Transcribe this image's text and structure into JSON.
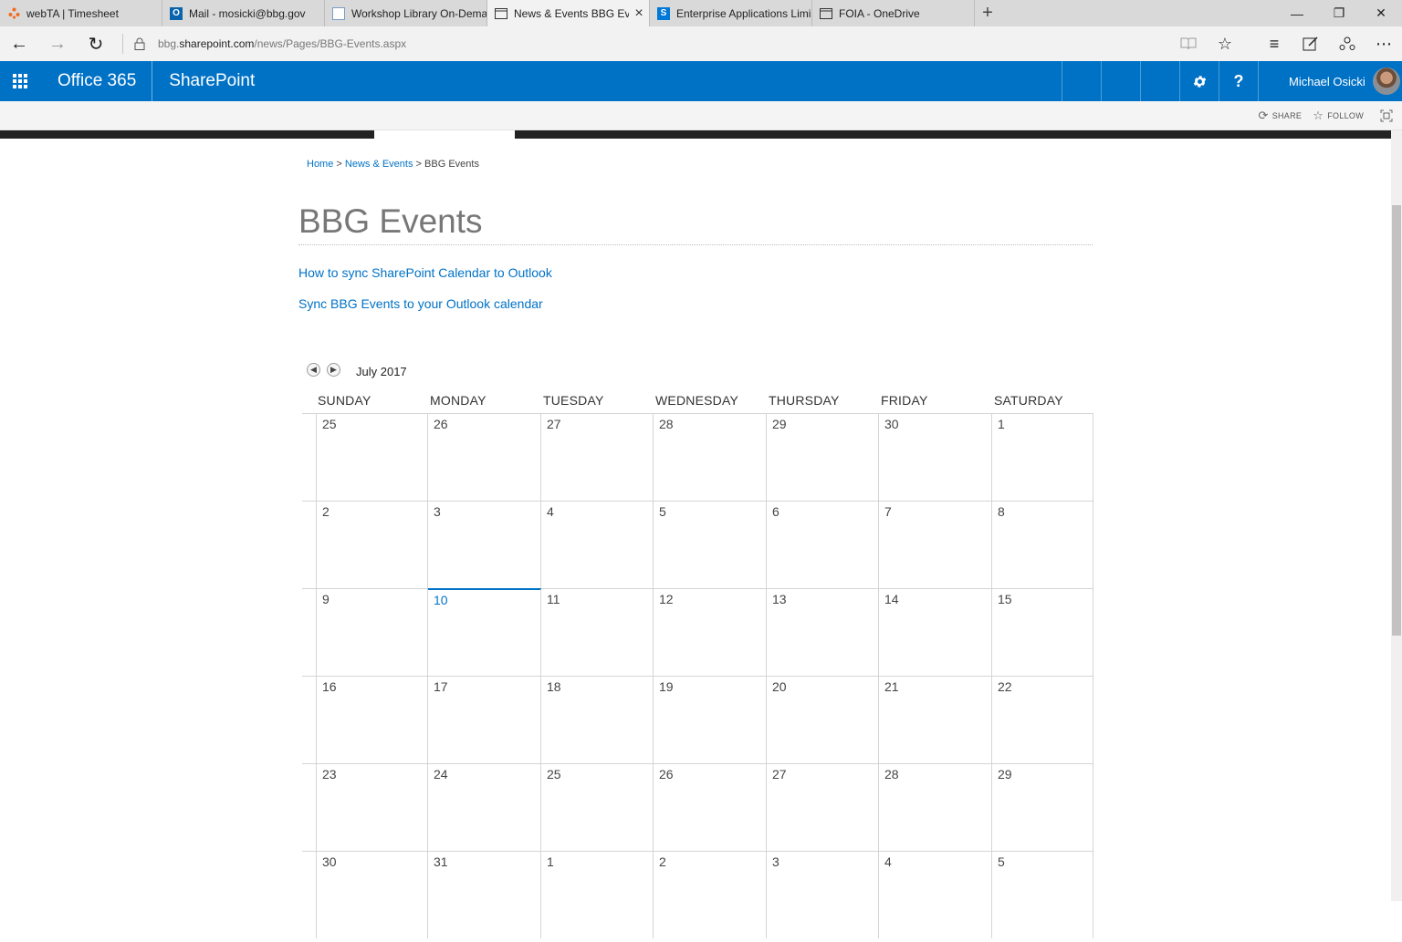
{
  "browser": {
    "tabs": [
      {
        "label": "webTA | Timesheet",
        "icon": "webta-icon",
        "active": false
      },
      {
        "label": "Mail - mosicki@bbg.gov",
        "icon": "outlook-icon",
        "active": false
      },
      {
        "label": "Workshop Library On-Dema",
        "icon": "workshop-icon",
        "active": false
      },
      {
        "label": "News & Events BBG Eve",
        "icon": "page-icon",
        "active": true
      },
      {
        "label": "Enterprise Applications Limi",
        "icon": "sharepoint-icon",
        "active": false
      },
      {
        "label": "FOIA - OneDrive",
        "icon": "page-icon",
        "active": false
      }
    ],
    "new_tab": "+",
    "url_host": "bbg.sharepoint.com",
    "url_path": "/news/Pages/BBG-Events.aspx",
    "url_prefix": "bbg.",
    "url_host_part": "sharepoint.com"
  },
  "suitebar": {
    "brand": "Office 365",
    "app": "SharePoint",
    "settings_icon": "gear-icon",
    "help_label": "?",
    "user_name": "Michael Osicki"
  },
  "ribbon": {
    "share_label": "SHARE",
    "follow_label": "FOLLOW"
  },
  "breadcrumb": {
    "home": "Home",
    "sep1": " > ",
    "news": "News & Events",
    "sep2": " > ",
    "current": "BBG Events"
  },
  "page": {
    "title": "BBG Events",
    "links": [
      "How to sync SharePoint Calendar to Outlook",
      "Sync BBG Events to your Outlook calendar"
    ]
  },
  "calendar": {
    "month_label": "July 2017",
    "weekdays": [
      "SUNDAY",
      "MONDAY",
      "TUESDAY",
      "WEDNESDAY",
      "THURSDAY",
      "FRIDAY",
      "SATURDAY"
    ],
    "today": 10,
    "weeks": [
      [
        "25",
        "26",
        "27",
        "28",
        "29",
        "30",
        "1"
      ],
      [
        "2",
        "3",
        "4",
        "5",
        "6",
        "7",
        "8"
      ],
      [
        "9",
        "10",
        "11",
        "12",
        "13",
        "14",
        "15"
      ],
      [
        "16",
        "17",
        "18",
        "19",
        "20",
        "21",
        "22"
      ],
      [
        "23",
        "24",
        "25",
        "26",
        "27",
        "28",
        "29"
      ],
      [
        "30",
        "31",
        "1",
        "2",
        "3",
        "4",
        "5"
      ]
    ]
  },
  "colors": {
    "suite_blue": "#0072c6",
    "link_blue": "#0072c6",
    "title_gray": "#777777"
  }
}
